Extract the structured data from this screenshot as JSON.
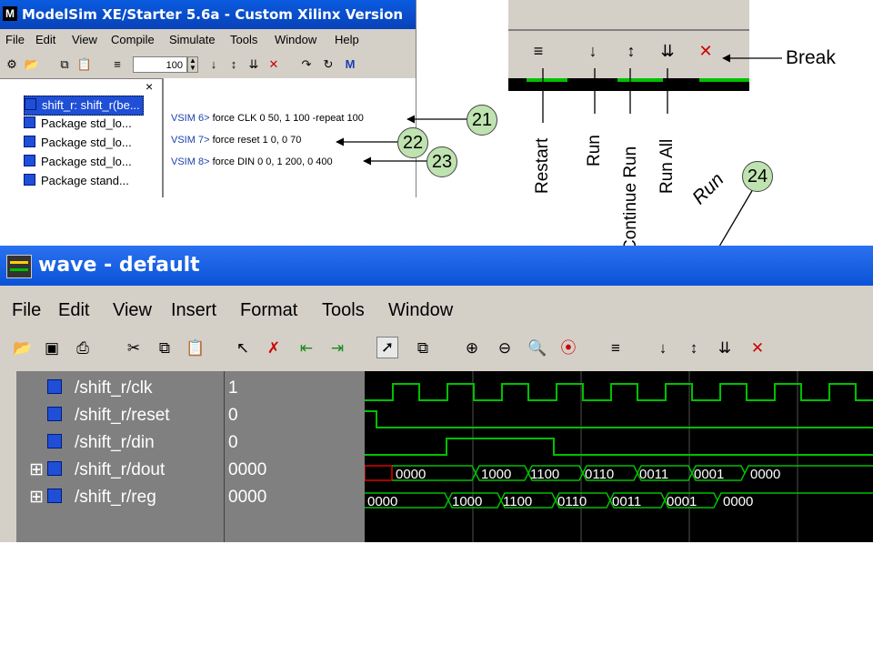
{
  "modelsim": {
    "title": "ModelSim XE/Starter 5.6a - Custom Xilinx Version",
    "menu": [
      "File",
      "Edit",
      "View",
      "Compile",
      "Simulate",
      "Tools",
      "Window",
      "Help"
    ],
    "run_length": "100",
    "tree_close": "×",
    "tree_items": [
      "shift_r: shift_r(be...",
      "Package std_lo...",
      "Package std_lo...",
      "Package std_lo...",
      "Package stand..."
    ],
    "console": [
      {
        "prompt": "VSIM 6>",
        "cmd": "force CLK 0 50, 1 100 -repeat 100"
      },
      {
        "prompt": "VSIM 7>",
        "cmd": "force reset 1 0, 0 70"
      },
      {
        "prompt": "VSIM 8>",
        "cmd": "force DIN 0 0, 1 200, 0 400"
      }
    ]
  },
  "annotations": {
    "callouts": [
      "21",
      "22",
      "23",
      "24"
    ],
    "labels": {
      "break": "Break",
      "restart": "Restart",
      "run": "Run",
      "continue": "Continue Run",
      "run_all": "Run All",
      "run_italic": "Run"
    }
  },
  "wave": {
    "title": "wave - default",
    "menu": [
      "File",
      "Edit",
      "View",
      "Insert",
      "Format",
      "Tools",
      "Window"
    ],
    "signals": [
      {
        "expand": "",
        "name": "/shift_r/clk",
        "value": "1"
      },
      {
        "expand": "",
        "name": "/shift_r/reset",
        "value": "0"
      },
      {
        "expand": "",
        "name": "/shift_r/din",
        "value": "0"
      },
      {
        "expand": "⊞",
        "name": "/shift_r/dout",
        "value": "0000"
      },
      {
        "expand": "⊞",
        "name": "/shift_r/reg",
        "value": "0000"
      }
    ],
    "dout_values": [
      "0000",
      "1000",
      "1100",
      "0110",
      "0011",
      "0001",
      "0000"
    ],
    "reg_values": [
      "0000",
      "1000",
      "1100",
      "0110",
      "0011",
      "0001",
      "0000"
    ]
  },
  "colors": {
    "signal": "#00c000",
    "wave_bg": "#000000",
    "circle": "#bfe3b0"
  }
}
